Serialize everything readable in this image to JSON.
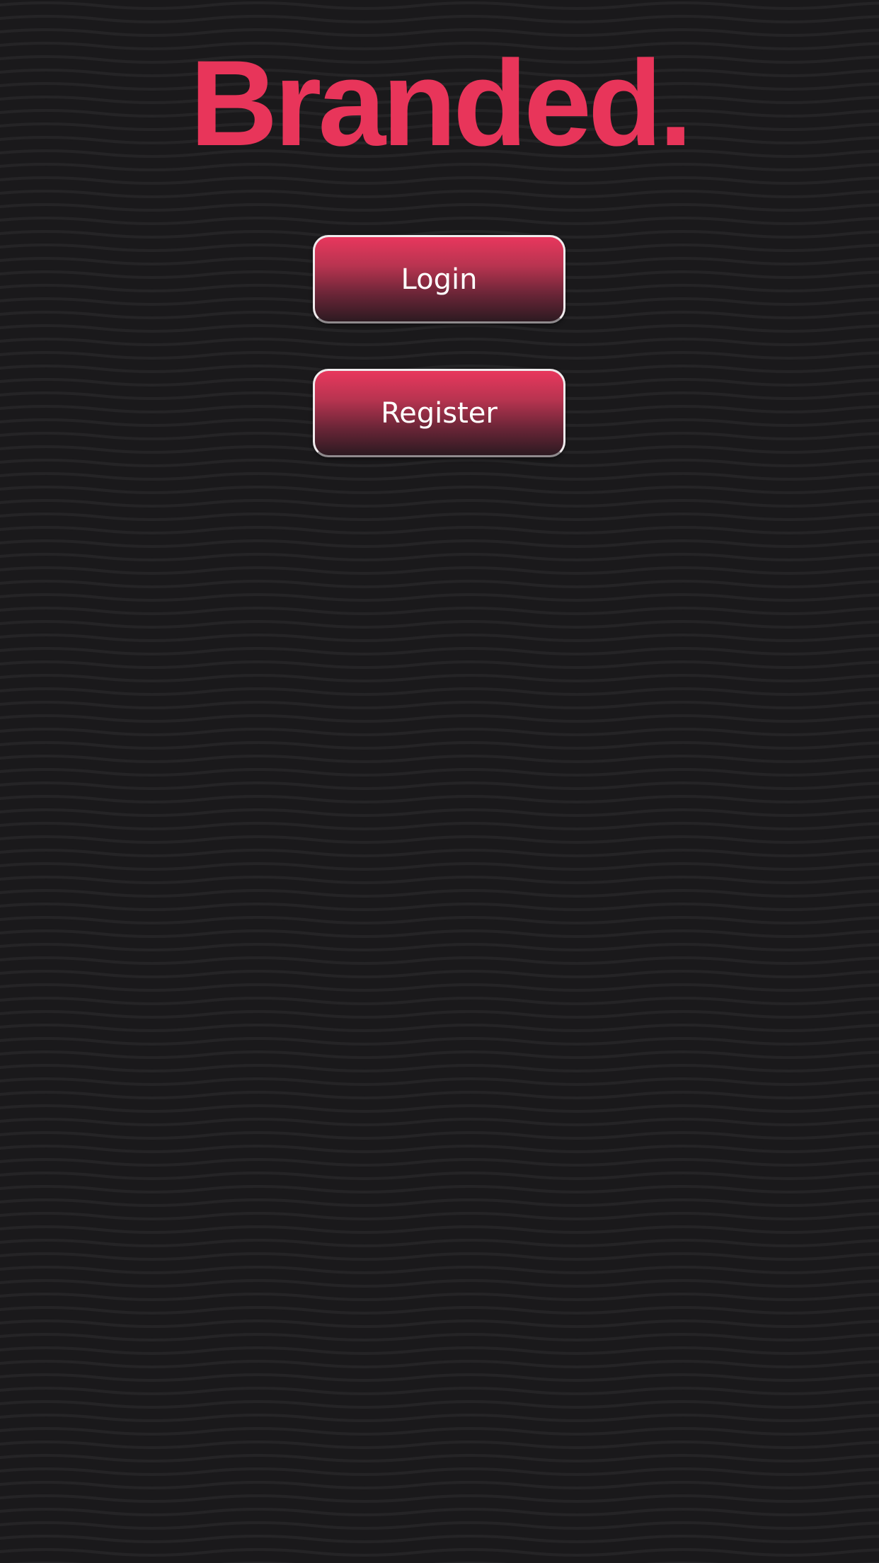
{
  "brand": {
    "logo_text": "Branded.",
    "accent_color": "#e8355a"
  },
  "actions": {
    "login_label": "Login",
    "register_label": "Register"
  },
  "theme": {
    "background": "#1a191b",
    "wave_line": "#242325"
  }
}
